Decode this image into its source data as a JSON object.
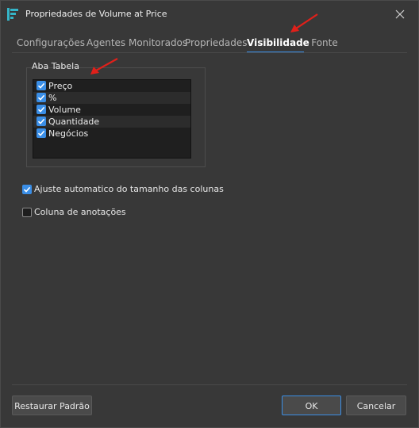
{
  "window": {
    "title": "Propriedades de Volume at Price"
  },
  "tabs": [
    {
      "label": "Configurações",
      "active": false
    },
    {
      "label": "Agentes Monitorados",
      "active": false
    },
    {
      "label": "Propriedades",
      "active": false
    },
    {
      "label": "Visibilidade",
      "active": true
    },
    {
      "label": "Fonte",
      "active": false
    }
  ],
  "table_group": {
    "label": "Aba Tabela",
    "items": [
      {
        "label": "Preço",
        "checked": true
      },
      {
        "label": "%",
        "checked": true
      },
      {
        "label": "Volume",
        "checked": true
      },
      {
        "label": "Quantidade",
        "checked": true
      },
      {
        "label": "Negócios",
        "checked": true
      }
    ]
  },
  "options": {
    "auto_size": {
      "label": "Ajuste automatico do tamanho das colunas",
      "checked": true
    },
    "notes_column": {
      "label": "Coluna de anotações",
      "checked": false
    }
  },
  "buttons": {
    "restore": "Restaurar Padrão",
    "ok": "OK",
    "cancel": "Cancelar"
  },
  "colors": {
    "accent": "#3a8ee6",
    "annotation_arrow": "#e0201a",
    "background": "#383838"
  },
  "icons": {
    "app": "volume-at-price-icon",
    "close": "close-icon",
    "check": "checkmark-icon",
    "annotation": "red-arrow-annotation"
  }
}
